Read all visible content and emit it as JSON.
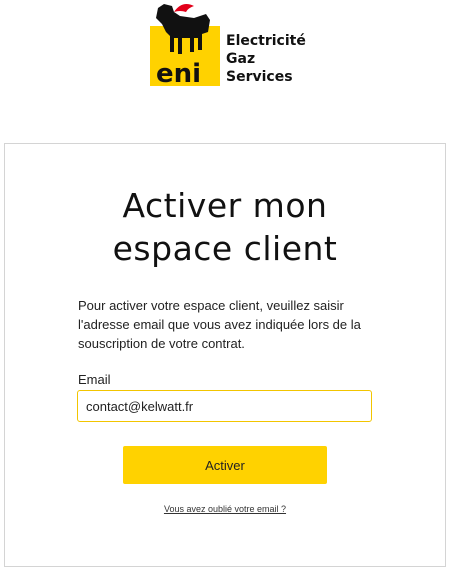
{
  "brand": {
    "logo_word": "eni",
    "tagline_lines": [
      "Electricité",
      "Gaz",
      "Services"
    ],
    "colors": {
      "yellow": "#ffd200",
      "black": "#111111",
      "red": "#e2001a"
    }
  },
  "form": {
    "title_lines": [
      "Activer mon",
      "espace client"
    ],
    "intro": "Pour activer votre espace client, veuillez saisir l'adresse email que vous avez indiquée lors de la souscription de votre contrat.",
    "email_label": "Email",
    "email_value": "contact@kelwatt.fr",
    "submit_label": "Activer",
    "forgot_link": "Vous avez oublié votre email ?"
  }
}
